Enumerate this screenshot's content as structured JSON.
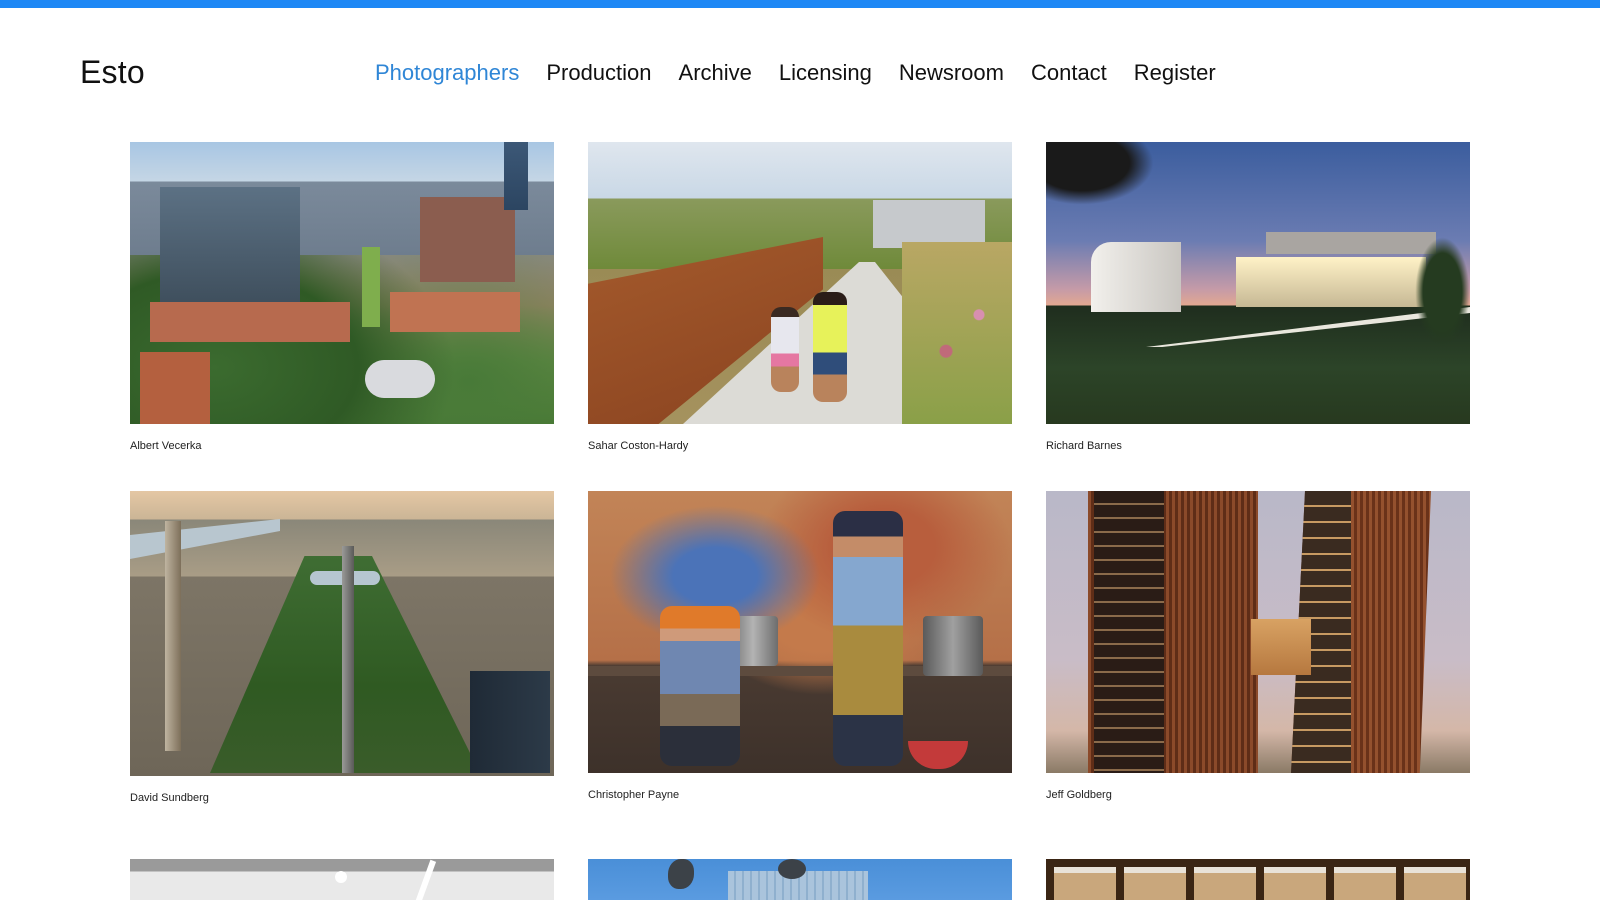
{
  "brand": {
    "logo": "Esto",
    "accent_color": "#1e88f5",
    "active_nav_color": "#2f86d6"
  },
  "nav": {
    "items": [
      {
        "label": "Photographers",
        "active": true
      },
      {
        "label": "Production",
        "active": false
      },
      {
        "label": "Archive",
        "active": false
      },
      {
        "label": "Licensing",
        "active": false
      },
      {
        "label": "Newsroom",
        "active": false
      },
      {
        "label": "Contact",
        "active": false
      },
      {
        "label": "Register",
        "active": false
      }
    ]
  },
  "photographers": [
    {
      "name": "Albert Vecerka"
    },
    {
      "name": "Sahar Coston-Hardy"
    },
    {
      "name": "Richard Barnes"
    },
    {
      "name": "David Sundberg"
    },
    {
      "name": "Christopher Payne"
    },
    {
      "name": "Jeff Goldberg"
    }
  ]
}
